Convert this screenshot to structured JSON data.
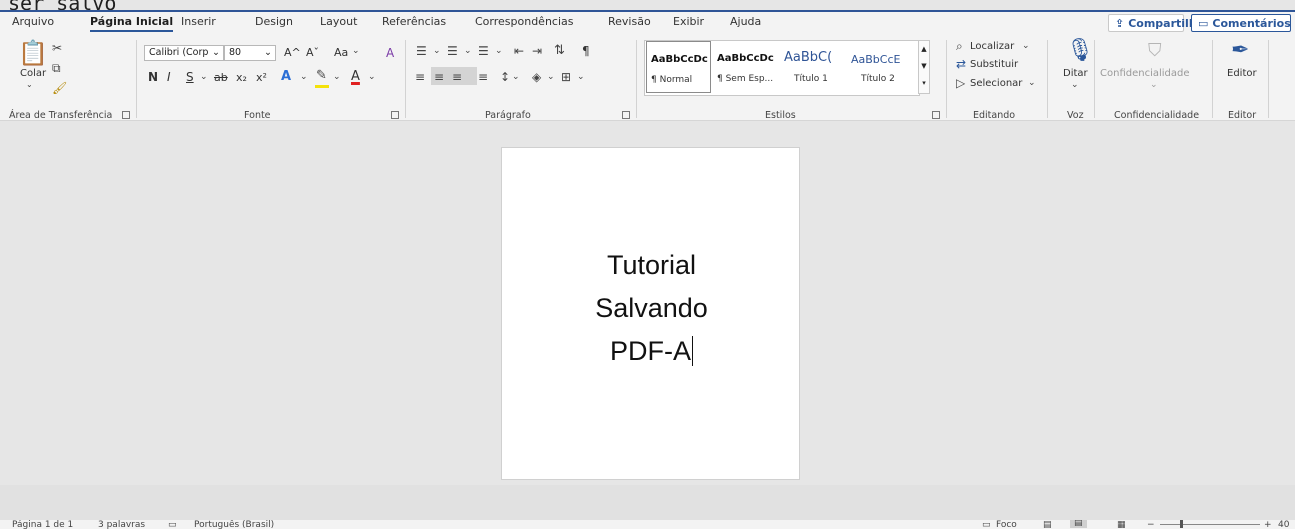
{
  "window": {
    "clipped_title": "ser salvo"
  },
  "tabs": [
    "Arquivo",
    "Página Inicial",
    "Inserir",
    "Design",
    "Layout",
    "Referências",
    "Correspondências",
    "Revisão",
    "Exibir",
    "Ajuda"
  ],
  "actions": {
    "share": "Compartilhar",
    "comments": "Comentários"
  },
  "clipboard": {
    "paste_label": "Colar",
    "group_label": "Área de Transferência"
  },
  "font": {
    "family": "Calibri (Corp",
    "size": "80",
    "case": "Aa",
    "group_label": "Fonte",
    "bold": "N",
    "italic": "I",
    "underline": "S",
    "strike": "ab",
    "subscript": "x₂",
    "superscript": "x²",
    "effects": "A",
    "color": "A",
    "grow": "A^",
    "shrink": "Aˇ",
    "clear_format": "A"
  },
  "paragraph": {
    "group_label": "Parágrafo",
    "pilcrow": "¶"
  },
  "styles": {
    "group_label": "Estilos",
    "items": [
      {
        "sample": "AaBbCcDc",
        "name": "¶ Normal"
      },
      {
        "sample": "AaBbCcDc",
        "name": "¶ Sem Esp..."
      },
      {
        "sample": "AaBbC(",
        "name": "Título 1"
      },
      {
        "sample": "AaBbCcE",
        "name": "Título 2"
      }
    ],
    "heading1_color": "#2f5496",
    "heading2_color": "#2f5496"
  },
  "editing": {
    "find": "Localizar",
    "replace": "Substituir",
    "select": "Selecionar",
    "group_label": "Editando"
  },
  "voice": {
    "dictate": "Ditar",
    "group_label": "Voz"
  },
  "sensitivity": {
    "label": "Confidencialidade",
    "group_label": "Confidencialidade"
  },
  "editor": {
    "label": "Editor",
    "group_label": "Editor"
  },
  "document": {
    "lines": [
      "Tutorial",
      "Salvando",
      "PDF-A"
    ]
  },
  "status": {
    "page": "Página 1 de 1",
    "words": "3 palavras",
    "language": "Português (Brasil)",
    "focus": "Foco",
    "zoom": "40"
  },
  "colors": {
    "accent": "#2b579a",
    "font_color_bar": "#e02020",
    "highlight_bar": "#f4e20a"
  }
}
